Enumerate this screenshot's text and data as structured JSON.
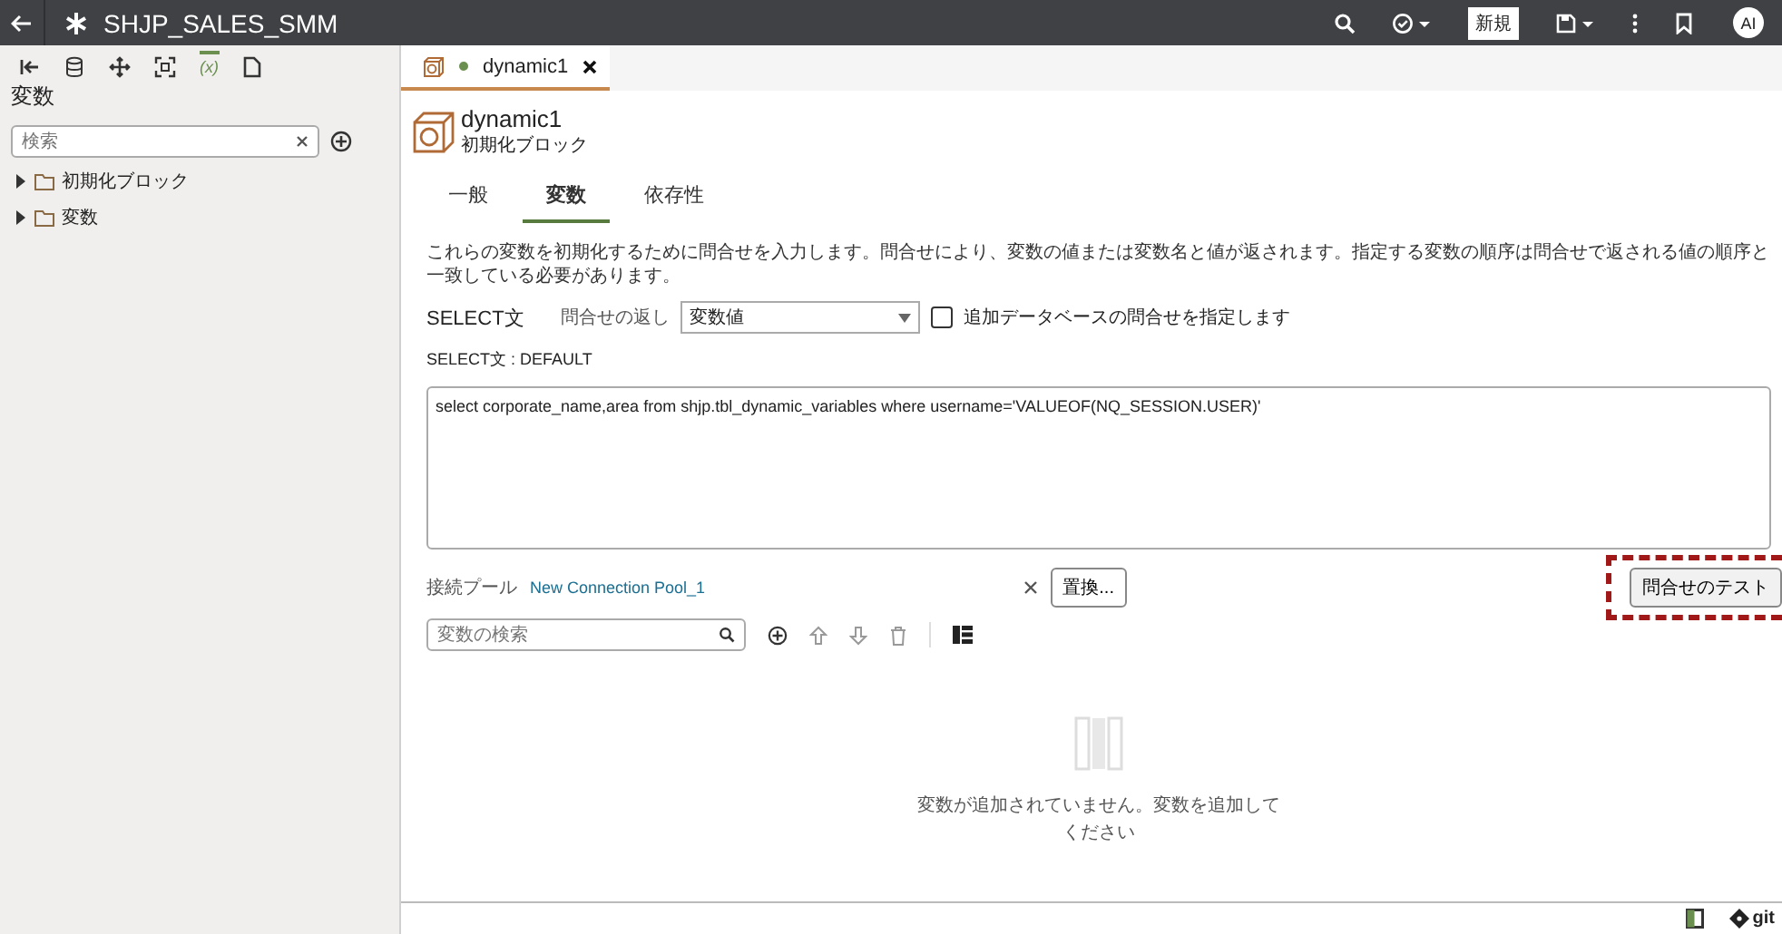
{
  "app_bar": {
    "title": "SHJP_SALES_SMM",
    "new_button": "新規",
    "avatar": "AI"
  },
  "sidebar": {
    "toolbar": [
      {
        "kind": "back",
        "selected": false
      },
      {
        "kind": "database",
        "selected": false
      },
      {
        "kind": "move",
        "selected": false
      },
      {
        "kind": "fit",
        "selected": false
      },
      {
        "kind": "variable",
        "glyph": "(x)",
        "selected": true
      },
      {
        "kind": "document",
        "selected": false
      }
    ],
    "title": "変数",
    "search": {
      "placeholder": "検索"
    },
    "tree": [
      {
        "label": "初期化ブロック",
        "expanded": false
      },
      {
        "label": "変数",
        "expanded": false
      }
    ]
  },
  "editor_tab": {
    "label": "dynamic1",
    "modified": true
  },
  "header": {
    "title": "dynamic1",
    "subtitle": "初期化ブロック"
  },
  "tabs": [
    {
      "label": "一般",
      "selected": false
    },
    {
      "label": "変数",
      "selected": true
    },
    {
      "label": "依存性",
      "selected": false
    }
  ],
  "description": "これらの変数を初期化するために問合せを入力します。問合せにより、変数の値または変数名と値が返されます。指定する変数の順序は問合せで返される値の順序と一致している必要があります。",
  "select_label": "SELECT文",
  "return_label": "問合せの返し",
  "return_value": "変数値",
  "extra_db": {
    "label": "追加データベースの問合せを指定します",
    "checked": false
  },
  "sql_label": "SELECT文 : DEFAULT",
  "sql": "select corporate_name,area from shjp.tbl_dynamic_variables where username='VALUEOF(NQ_SESSION.USER)'",
  "pool_label": "接続プール",
  "pool_link": "New Connection Pool_1",
  "replace_button": "置換...",
  "test_button": {
    "label": "問合せのテスト",
    "highlighted": true
  },
  "var_search": {
    "placeholder": "変数の検索"
  },
  "empty_message": "変数が追加されていません。変数を追加してください",
  "status_bar": {
    "git": "git"
  }
}
